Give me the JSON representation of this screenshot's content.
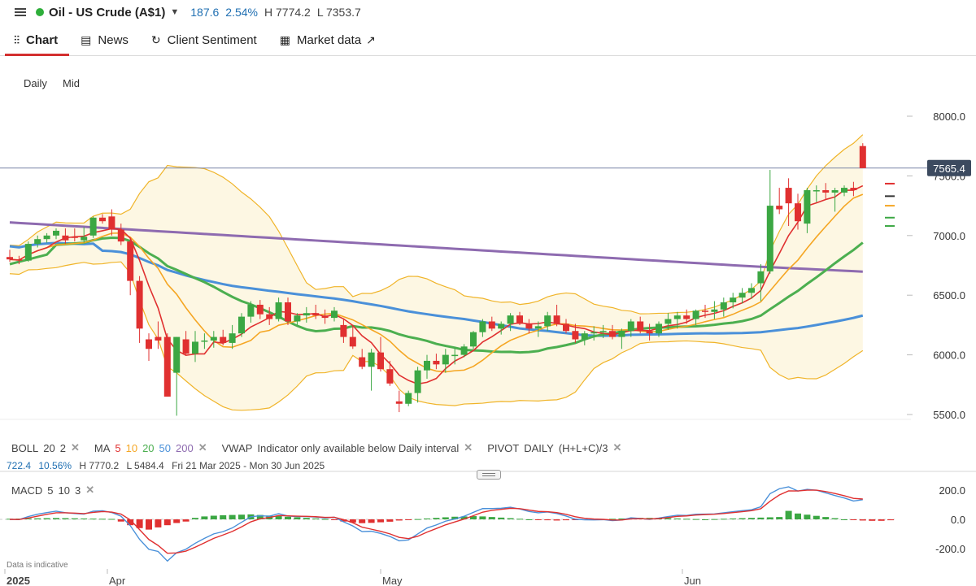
{
  "header": {
    "instrument": "Oil - US Crude (A$1)",
    "change": "187.6",
    "change_pct": "2.54%",
    "high": "H 7774.2",
    "low": "L 7353.7",
    "status_color": "#2eae3a"
  },
  "tabs": [
    {
      "label": "Chart",
      "icon": "chart-icon",
      "active": true
    },
    {
      "label": "News",
      "icon": "news-icon"
    },
    {
      "label": "Client Sentiment",
      "icon": "sentiment-icon"
    },
    {
      "label": "Market data",
      "icon": "market-data-icon"
    }
  ],
  "timeframe": {
    "interval": "Daily",
    "price_type": "Mid"
  },
  "indicators": {
    "boll": {
      "label": "BOLL",
      "p1": "20",
      "p2": "2"
    },
    "ma": {
      "label": "MA",
      "periods": [
        "5",
        "10",
        "20",
        "50",
        "200"
      ]
    },
    "vwap": {
      "label": "VWAP",
      "note": "Indicator only available below Daily interval"
    },
    "pivot": {
      "label": "PIVOT",
      "mode": "DAILY",
      "formula": "(H+L+C)/3"
    },
    "close_glyph": "✕"
  },
  "stats": {
    "range": "722.4",
    "range_pct": "10.56%",
    "high": "H 7770.2",
    "low": "L 5484.4",
    "period": "Fri 21 Mar 2025 - Mon 30 Jun 2025"
  },
  "macd": {
    "label": "MACD",
    "fast": "5",
    "slow": "10",
    "signal": "3"
  },
  "disclaimer": "Data is indicative",
  "colors": {
    "up": "#3ba743",
    "down": "#e03030",
    "ma5": "#e03030",
    "ma10": "#f5a623",
    "ma20": "#4caf50",
    "ma50": "#4a90d9",
    "ma200": "#8e6bb0",
    "boll": "#f0b429",
    "boll_fill": "#fdf7e3",
    "macd_line": "#4a90d9",
    "signal_line": "#e03030"
  },
  "chart_data": [
    {
      "type": "candlestick",
      "interval": "Daily",
      "ylim": [
        5400,
        8100
      ],
      "y_ticks": [
        "8000.0",
        "7500.0",
        "7000.0",
        "6500.0",
        "6000.0",
        "5500.0"
      ],
      "x_ticks": [
        "2025",
        "Apr",
        "May",
        "Jun"
      ],
      "current_price": "7565.4",
      "candles": [
        [
          6820,
          6880,
          6780,
          6800
        ],
        [
          6800,
          6830,
          6760,
          6790
        ],
        [
          6790,
          6950,
          6780,
          6930
        ],
        [
          6930,
          7000,
          6900,
          6970
        ],
        [
          6970,
          7020,
          6940,
          7000
        ],
        [
          7000,
          7060,
          6970,
          7040
        ],
        [
          7000,
          7060,
          6930,
          6960
        ],
        [
          6990,
          7060,
          6950,
          6980
        ],
        [
          6960,
          7070,
          6940,
          6990
        ],
        [
          7000,
          7160,
          6980,
          7150
        ],
        [
          7150,
          7180,
          7100,
          7120
        ],
        [
          7160,
          7220,
          7000,
          7050
        ],
        [
          7050,
          7100,
          6920,
          6950
        ],
        [
          6950,
          6980,
          6500,
          6620
        ],
        [
          6620,
          6660,
          6100,
          6220
        ],
        [
          6130,
          6180,
          5950,
          6050
        ],
        [
          6150,
          6280,
          6050,
          6120
        ],
        [
          6150,
          6180,
          5650,
          5650
        ],
        [
          5850,
          6150,
          5490,
          6150
        ],
        [
          6130,
          6200,
          6000,
          6010
        ],
        [
          6010,
          6200,
          5940,
          6110
        ],
        [
          6110,
          6180,
          6050,
          6120
        ],
        [
          6120,
          6200,
          6060,
          6150
        ],
        [
          6150,
          6210,
          6080,
          6100
        ],
        [
          6100,
          6250,
          6050,
          6180
        ],
        [
          6180,
          6350,
          6150,
          6320
        ],
        [
          6320,
          6450,
          6270,
          6420
        ],
        [
          6420,
          6460,
          6300,
          6340
        ],
        [
          6340,
          6400,
          6250,
          6300
        ],
        [
          6300,
          6480,
          6280,
          6440
        ],
        [
          6440,
          6480,
          6250,
          6280
        ],
        [
          6280,
          6350,
          6250,
          6330
        ],
        [
          6330,
          6400,
          6270,
          6350
        ],
        [
          6350,
          6420,
          6300,
          6330
        ],
        [
          6330,
          6380,
          6260,
          6310
        ],
        [
          6310,
          6400,
          6280,
          6370
        ],
        [
          6250,
          6300,
          6100,
          6150
        ],
        [
          6150,
          6250,
          6050,
          6070
        ],
        [
          5980,
          6050,
          5880,
          5900
        ],
        [
          5900,
          6050,
          5700,
          6020
        ],
        [
          6020,
          6150,
          5860,
          5880
        ],
        [
          5880,
          5950,
          5740,
          5760
        ],
        [
          5610,
          5700,
          5520,
          5590
        ],
        [
          5590,
          5700,
          5570,
          5680
        ],
        [
          5680,
          5900,
          5600,
          5870
        ],
        [
          5870,
          6000,
          5800,
          5950
        ],
        [
          5950,
          6010,
          5880,
          5920
        ],
        [
          5920,
          6050,
          5850,
          6000
        ],
        [
          6000,
          6060,
          5920,
          6000
        ],
        [
          6000,
          6090,
          5980,
          6070
        ],
        [
          6070,
          6200,
          6050,
          6190
        ],
        [
          6190,
          6300,
          6150,
          6280
        ],
        [
          6280,
          6320,
          6200,
          6220
        ],
        [
          6220,
          6280,
          6170,
          6260
        ],
        [
          6260,
          6350,
          6200,
          6330
        ],
        [
          6330,
          6360,
          6250,
          6260
        ],
        [
          6260,
          6300,
          6180,
          6220
        ],
        [
          6220,
          6280,
          6150,
          6240
        ],
        [
          6240,
          6360,
          6200,
          6330
        ],
        [
          6330,
          6420,
          6240,
          6260
        ],
        [
          6260,
          6300,
          6180,
          6200
        ],
        [
          6200,
          6260,
          6100,
          6130
        ],
        [
          6130,
          6200,
          6080,
          6180
        ],
        [
          6180,
          6240,
          6120,
          6190
        ],
        [
          6190,
          6250,
          6140,
          6200
        ],
        [
          6200,
          6250,
          6130,
          6150
        ],
        [
          6150,
          6220,
          6050,
          6200
        ],
        [
          6200,
          6300,
          6150,
          6280
        ],
        [
          6280,
          6320,
          6180,
          6200
        ],
        [
          6200,
          6260,
          6120,
          6180
        ],
        [
          6180,
          6280,
          6150,
          6260
        ],
        [
          6260,
          6350,
          6210,
          6300
        ],
        [
          6300,
          6360,
          6220,
          6330
        ],
        [
          6330,
          6380,
          6260,
          6300
        ],
        [
          6300,
          6380,
          6250,
          6370
        ],
        [
          6370,
          6420,
          6310,
          6360
        ],
        [
          6360,
          6450,
          6300,
          6380
        ],
        [
          6380,
          6480,
          6320,
          6440
        ],
        [
          6440,
          6520,
          6390,
          6480
        ],
        [
          6480,
          6560,
          6430,
          6520
        ],
        [
          6520,
          6600,
          6470,
          6560
        ],
        [
          6600,
          6760,
          6450,
          6700
        ],
        [
          6700,
          7550,
          6680,
          7250
        ],
        [
          7250,
          7400,
          7180,
          7220
        ],
        [
          7400,
          7480,
          7080,
          7270
        ],
        [
          7270,
          7350,
          7050,
          7120
        ],
        [
          7100,
          7400,
          7020,
          7380
        ],
        [
          7380,
          7420,
          7280,
          7380
        ],
        [
          7380,
          7440,
          7300,
          7360
        ],
        [
          7360,
          7400,
          7200,
          7380
        ],
        [
          7360,
          7420,
          7330,
          7400
        ],
        [
          7400,
          7450,
          7330,
          7380
        ],
        [
          7750,
          7774,
          7600,
          7565
        ]
      ],
      "macd_ylim": [
        -300,
        300
      ],
      "macd_y_ticks": [
        "200.0",
        "0.0",
        "-200.0"
      ],
      "macd_histogram": [
        4,
        5,
        6,
        7,
        8,
        9,
        8,
        7,
        6,
        5,
        4,
        3,
        -15,
        -40,
        -60,
        -70,
        -55,
        -40,
        -25,
        -15,
        10,
        20,
        25,
        28,
        30,
        32,
        34,
        30,
        26,
        22,
        18,
        14,
        10,
        6,
        2,
        -2,
        -15,
        -22,
        -26,
        -24,
        -20,
        -16,
        -8,
        -2,
        2,
        6,
        10,
        14,
        18,
        20,
        22,
        20,
        16,
        12,
        8,
        4,
        0,
        -4,
        -6,
        -8,
        -6,
        -4,
        -2,
        0,
        2,
        4,
        6,
        8,
        10,
        10,
        9,
        8,
        6,
        4,
        2,
        0,
        2,
        4,
        6,
        8,
        10,
        12,
        14,
        16,
        58,
        40,
        32,
        24,
        16,
        8,
        0,
        -4,
        -8,
        -10,
        -10,
        -6
      ]
    }
  ]
}
